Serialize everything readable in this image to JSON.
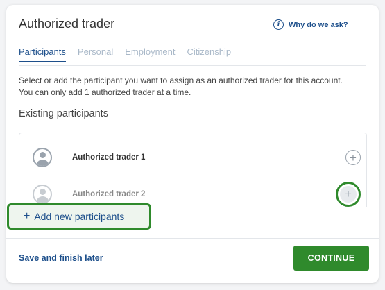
{
  "header": {
    "title": "Authorized trader",
    "why_link": "Why do we ask?",
    "info_icon_glyph": "i"
  },
  "tabs": [
    {
      "label": "Participants",
      "active": true
    },
    {
      "label": "Personal",
      "active": false
    },
    {
      "label": "Employment",
      "active": false
    },
    {
      "label": "Citizenship",
      "active": false
    }
  ],
  "description": "Select or add the participant you want to assign as an authorized trader for this account. You can only add 1 authorized trader at a time.",
  "existing": {
    "heading": "Existing participants",
    "participants": [
      {
        "name": "Authorized trader 1",
        "icon": "user-avatar-icon"
      },
      {
        "name": "Authorized trader 2",
        "icon": "user-avatar-icon"
      }
    ],
    "add_icon_glyph": "+"
  },
  "add_new": {
    "plus": "+",
    "label": "Add new participants"
  },
  "footer": {
    "save_later": "Save and finish later",
    "continue": "CONTINUE"
  },
  "colors": {
    "accent_blue": "#1d4f8b",
    "primary_green": "#2f8a2c"
  }
}
